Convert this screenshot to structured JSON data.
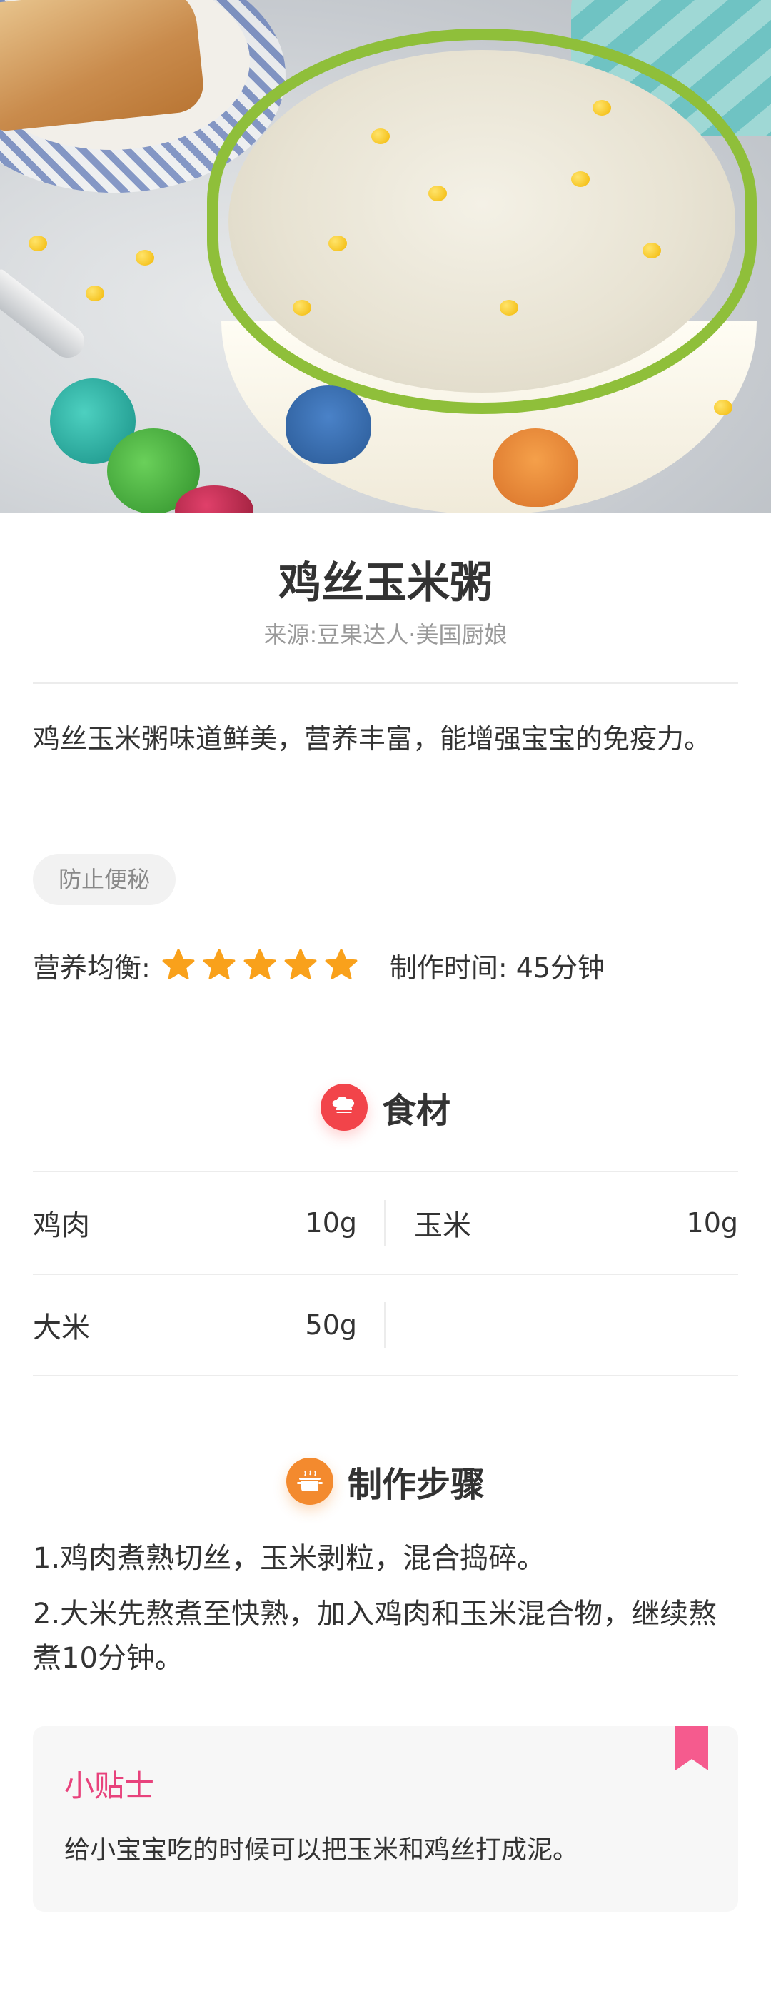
{
  "recipe": {
    "title": "鸡丝玉米粥",
    "source": "来源:豆果达人·美国厨娘",
    "description": "鸡丝玉米粥味道鲜美，营养丰富，能增强宝宝的免疫力。",
    "tag": "防止便秘",
    "nutrition_label": "营养均衡:",
    "nutrition_stars": 5,
    "time_label": "制作时间: 45分钟"
  },
  "ingredients": {
    "heading": "食材",
    "items": [
      {
        "name": "鸡肉",
        "amount": "10g"
      },
      {
        "name": "玉米",
        "amount": "10g"
      },
      {
        "name": "大米",
        "amount": "50g"
      }
    ]
  },
  "steps": {
    "heading": "制作步骤",
    "items": [
      "1.鸡肉煮熟切丝，玉米剥粒，混合捣碎。",
      "2.大米先熬煮至快熟，加入鸡肉和玉米混合物，继续熬煮10分钟。"
    ]
  },
  "tip": {
    "title": "小贴士",
    "body": "给小宝宝吃的时候可以把玉米和鸡丝打成泥。"
  },
  "colors": {
    "star": "#f9a11b",
    "ingredient_icon": "#f2444a",
    "steps_icon": "#f38a2e",
    "tip_title": "#e8427c",
    "bookmark": "#f55b8e"
  },
  "icons": {
    "ingredients": "chef-hat-icon",
    "steps": "cooking-pot-icon",
    "tip": "bookmark-icon"
  }
}
